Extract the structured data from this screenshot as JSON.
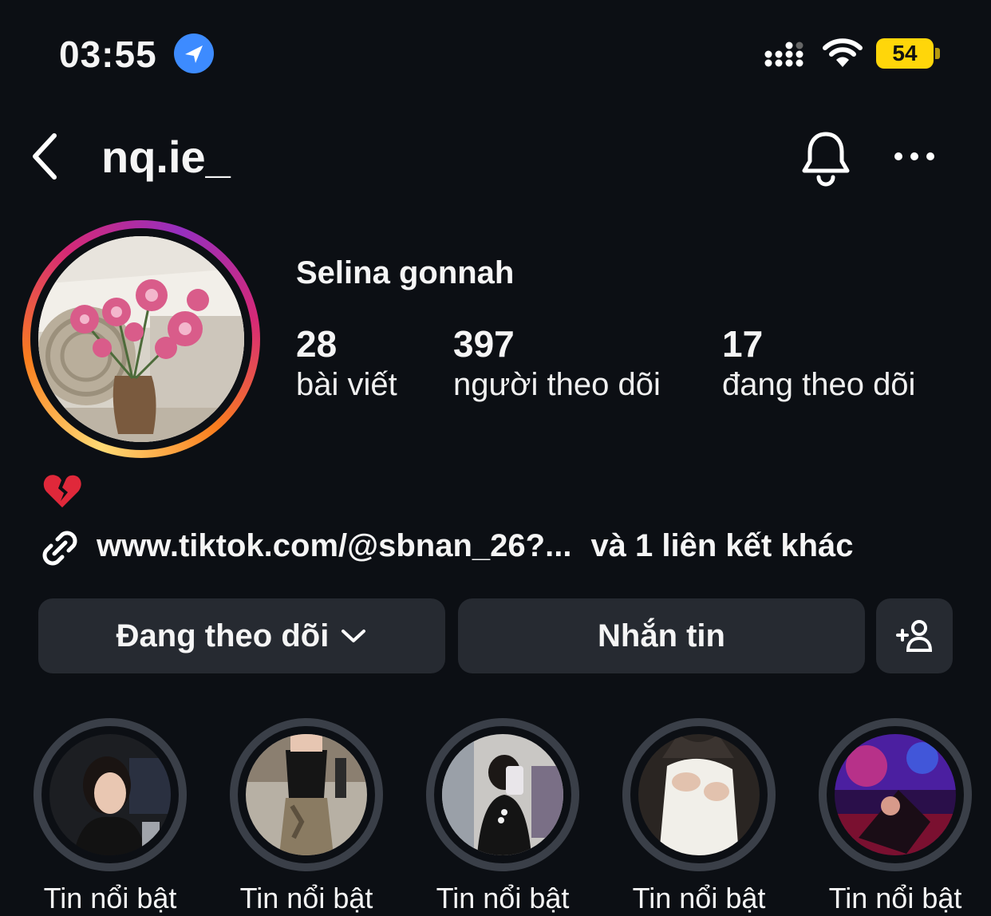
{
  "status_bar": {
    "time": "03:55",
    "battery": "54",
    "colors": {
      "battery": "#ffd60a",
      "location": "#3d8bff"
    }
  },
  "header": {
    "username": "nq.ie_",
    "icons": [
      "back-icon",
      "bell-icon",
      "more-icon"
    ]
  },
  "profile": {
    "display_name": "Selina gonnah",
    "stats": [
      {
        "value": "28",
        "label": "bài viết"
      },
      {
        "value": "397",
        "label": "người theo dõi"
      },
      {
        "value": "17",
        "label": "đang theo dõi"
      }
    ],
    "bio_emoji": "broken-heart-icon",
    "link_text": "www.tiktok.com/@sbnan_26?...",
    "link_more": "và 1 liên kết khác"
  },
  "buttons": {
    "following": "Đang theo dõi",
    "message": "Nhắn tin"
  },
  "highlights": [
    {
      "label": "Tin nổi bật"
    },
    {
      "label": "Tin nổi bật"
    },
    {
      "label": "Tin nổi bật"
    },
    {
      "label": "Tin nổi bật"
    },
    {
      "label": "Tin nổi bật"
    }
  ],
  "colors": {
    "background": "#0c0f14",
    "button": "#262a31",
    "story_ring": [
      "#feda75",
      "#fa7e1e",
      "#d62976",
      "#962fbf"
    ]
  }
}
